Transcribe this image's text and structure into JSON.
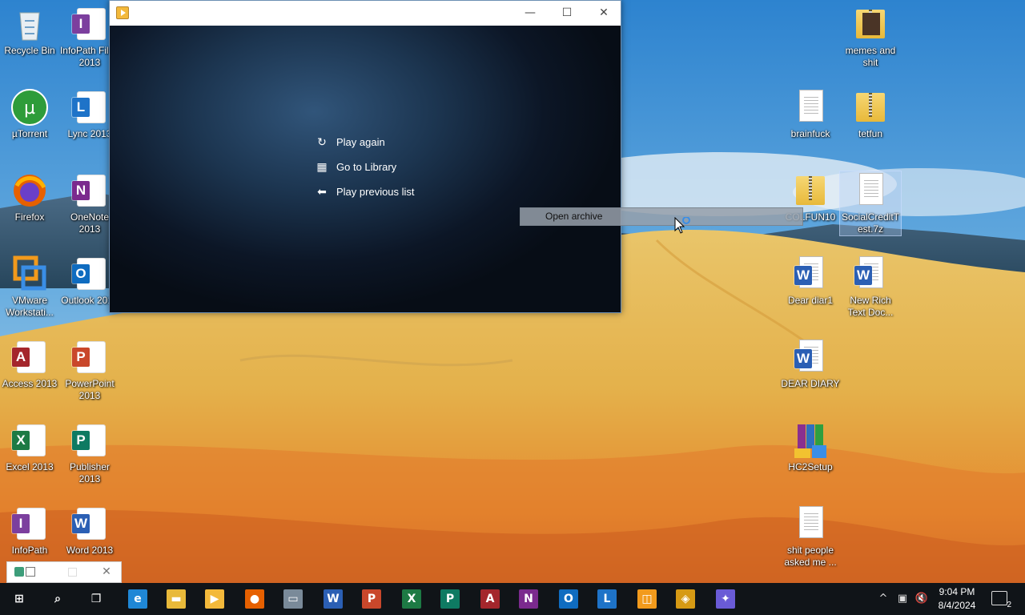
{
  "desktop": {
    "icons_left": [
      {
        "label": "Recycle Bin",
        "icon": "recycle-bin-icon"
      },
      {
        "label": "InfoPath Filler 2013",
        "icon": "infopath-filler-icon",
        "glyph": "I",
        "color": "#7c3f9e"
      },
      {
        "label": "µTorrent",
        "icon": "utorrent-icon"
      },
      {
        "label": "Lync 2013",
        "icon": "lync-icon",
        "glyph": "L",
        "color": "#1e73c8"
      },
      {
        "label": "Firefox",
        "icon": "firefox-icon"
      },
      {
        "label": "OneNote 2013",
        "icon": "onenote-icon",
        "glyph": "N",
        "color": "#7b2a8e"
      },
      {
        "label": "VMware Workstati...",
        "icon": "vmware-icon"
      },
      {
        "label": "Outlook 2013",
        "icon": "outlook-icon",
        "glyph": "O",
        "color": "#0f6cc0"
      },
      {
        "label": "Access 2013",
        "icon": "access-icon",
        "glyph": "A",
        "color": "#a4262c"
      },
      {
        "label": "PowerPoint 2013",
        "icon": "powerpoint-icon",
        "glyph": "P",
        "color": "#c9472b"
      },
      {
        "label": "Excel 2013",
        "icon": "excel-icon",
        "glyph": "X",
        "color": "#1d7a44"
      },
      {
        "label": "Publisher 2013",
        "icon": "publisher-icon",
        "glyph": "P",
        "color": "#0e7a62"
      },
      {
        "label": "InfoPath",
        "icon": "infopath-icon",
        "glyph": "I",
        "color": "#7c3f9e"
      },
      {
        "label": "Word 2013",
        "icon": "word-icon",
        "glyph": "W",
        "color": "#2b5fb4"
      }
    ],
    "icons_right": [
      {
        "label": "memes and shit",
        "icon": "folder-photo-icon"
      },
      {
        "label": "brainfuck",
        "icon": "text-file-icon"
      },
      {
        "label": "tetfun",
        "icon": "zip-folder-icon"
      },
      {
        "label": "COLFUN10",
        "icon": "zip-folder-icon"
      },
      {
        "label": "SocialCreditTest.7z",
        "icon": "blank-file-icon"
      },
      {
        "label": "Dear diar1",
        "icon": "word-doc-icon"
      },
      {
        "label": "New Rich Text Doc...",
        "icon": "word-doc-icon"
      },
      {
        "label": "DEAR DIARY",
        "icon": "word-doc-icon"
      },
      {
        "label": "HC2Setup",
        "icon": "winrar-installer-icon"
      },
      {
        "label": "shit people asked me ...",
        "icon": "notepad-file-icon"
      }
    ]
  },
  "player": {
    "menu": [
      {
        "label": "Play again",
        "icon": "replay-icon",
        "glyph": "↻"
      },
      {
        "label": "Go to Library",
        "icon": "library-icon",
        "glyph": "▦"
      },
      {
        "label": "Play previous list",
        "icon": "back-arrow-icon",
        "glyph": "⬅"
      }
    ],
    "titlebar": {
      "minimize": "—",
      "maximize": "☐",
      "close": "✕"
    }
  },
  "tooltip": {
    "open_archive": "Open archive"
  },
  "taskbar": {
    "apps": [
      {
        "name": "start-button",
        "glyph": "⊞",
        "color": "#101418"
      },
      {
        "name": "search-button",
        "glyph": "⌕",
        "color": "#101418"
      },
      {
        "name": "task-view-button",
        "glyph": "❐",
        "color": "#101418"
      },
      {
        "name": "taskbar-edge",
        "glyph": "e",
        "color": "#1f87d6"
      },
      {
        "name": "taskbar-file-explorer",
        "glyph": "▬",
        "color": "#e8b93a"
      },
      {
        "name": "taskbar-media-player",
        "glyph": "▶",
        "color": "#f3b93b"
      },
      {
        "name": "taskbar-firefox",
        "glyph": "●",
        "color": "#e66000"
      },
      {
        "name": "taskbar-remote-desktop",
        "glyph": "▭",
        "color": "#7a8a99"
      },
      {
        "name": "taskbar-word",
        "glyph": "W",
        "color": "#2b5fb4"
      },
      {
        "name": "taskbar-powerpoint",
        "glyph": "P",
        "color": "#c9472b"
      },
      {
        "name": "taskbar-excel",
        "glyph": "X",
        "color": "#1d7a44"
      },
      {
        "name": "taskbar-publisher",
        "glyph": "P",
        "color": "#0e7a62"
      },
      {
        "name": "taskbar-access",
        "glyph": "A",
        "color": "#a4262c"
      },
      {
        "name": "taskbar-onenote",
        "glyph": "N",
        "color": "#7b2a8e"
      },
      {
        "name": "taskbar-outlook",
        "glyph": "O",
        "color": "#0f6cc0"
      },
      {
        "name": "taskbar-lync",
        "glyph": "L",
        "color": "#1e73c8"
      },
      {
        "name": "taskbar-vmware",
        "glyph": "◫",
        "color": "#f29a1c"
      },
      {
        "name": "taskbar-app-yellow",
        "glyph": "◈",
        "color": "#d69a14"
      },
      {
        "name": "taskbar-app-bird",
        "glyph": "✦",
        "color": "#6a5bd6"
      }
    ],
    "clock": {
      "time": "9:04 PM",
      "date": "8/4/2024"
    },
    "tray": {
      "chevron": "^",
      "network": "▣",
      "volume": "🔇",
      "notifications": "2"
    }
  },
  "colors": {
    "taskbar": "#101418",
    "player_bg": "#0c1626"
  }
}
